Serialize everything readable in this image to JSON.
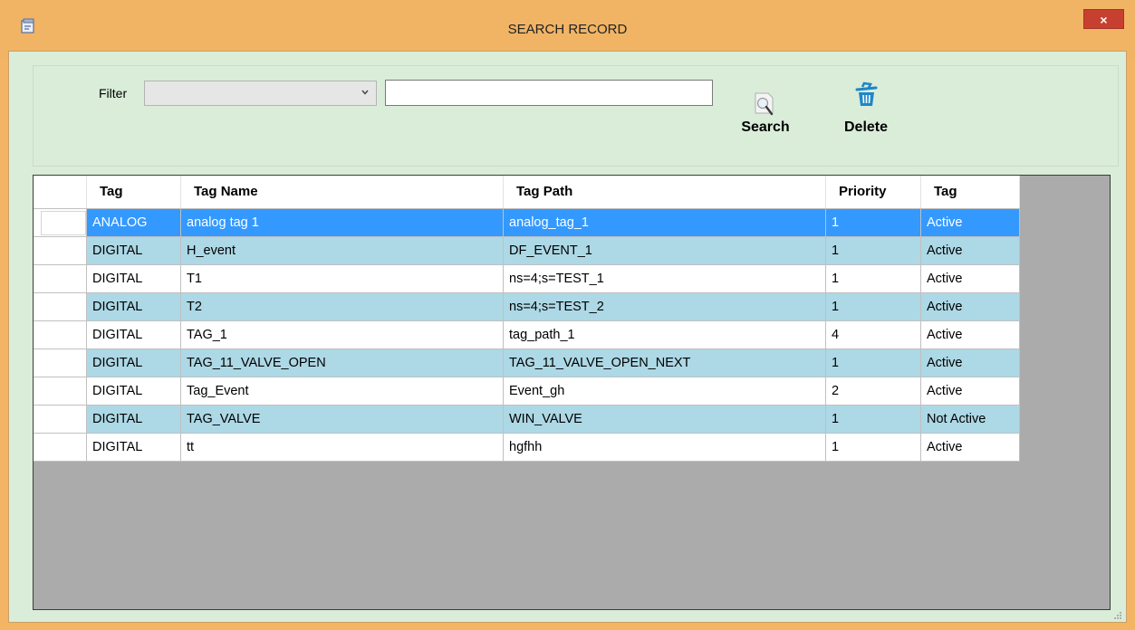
{
  "window": {
    "title": "SEARCH RECORD",
    "close_label": "×"
  },
  "filter": {
    "label": "Filter",
    "select_value": "",
    "text_value": ""
  },
  "toolbar": {
    "search_label": "Search",
    "delete_label": "Delete"
  },
  "colors": {
    "titlebar": "#f1b465",
    "client_bg": "#d9edd9",
    "row_alt": "#add8e6",
    "row_selected": "#3399ff",
    "grid_bg": "#ababab",
    "close_button": "#c7402f"
  },
  "table": {
    "columns": [
      "Tag",
      "Tag Name",
      "Tag Path",
      "Priority",
      "Tag"
    ],
    "rows": [
      [
        "ANALOG",
        "analog tag 1",
        "analog_tag_1",
        "1",
        "Active"
      ],
      [
        "DIGITAL",
        "H_event",
        "DF_EVENT_1",
        "1",
        "Active"
      ],
      [
        "DIGITAL",
        "T1",
        "ns=4;s=TEST_1",
        "1",
        "Active"
      ],
      [
        "DIGITAL",
        "T2",
        "ns=4;s=TEST_2",
        "1",
        "Active"
      ],
      [
        "DIGITAL",
        "TAG_1",
        "tag_path_1",
        "4",
        "Active"
      ],
      [
        "DIGITAL",
        "TAG_11_VALVE_OPEN",
        "TAG_11_VALVE_OPEN_NEXT",
        "1",
        "Active"
      ],
      [
        "DIGITAL",
        "Tag_Event",
        "Event_gh",
        "2",
        "Active"
      ],
      [
        "DIGITAL",
        "TAG_VALVE",
        "WIN_VALVE",
        "1",
        "Not Active"
      ],
      [
        "DIGITAL",
        "tt",
        "hgfhh",
        "1",
        "Active"
      ]
    ]
  }
}
